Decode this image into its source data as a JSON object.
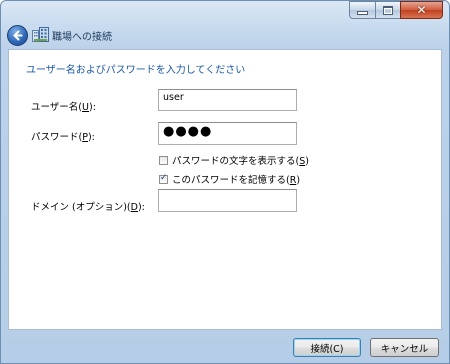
{
  "window": {
    "title": "職場への接続",
    "caption_buttons": [
      "minimize-icon",
      "maximize-icon",
      "close-icon"
    ]
  },
  "form": {
    "instruction": "ユーザー名およびパスワードを入力してください",
    "username": {
      "label_prefix": "ユーザー名(",
      "label_key": "U",
      "label_suffix": "):",
      "value": "user"
    },
    "password": {
      "label_prefix": "パスワード(",
      "label_key": "P",
      "label_suffix": "):",
      "value_masked": "●●●●"
    },
    "show_chars": {
      "label_prefix": "パスワードの文字を表示する(",
      "label_key": "S",
      "label_suffix": ")",
      "checked": false
    },
    "remember": {
      "label_prefix": "このパスワードを記憶する(",
      "label_key": "R",
      "label_suffix": ")",
      "checked": true
    },
    "domain": {
      "label_prefix": "ドメイン (オプション)(",
      "label_key": "D",
      "label_suffix": "):",
      "value": ""
    }
  },
  "buttons": {
    "connect": "接続(C)",
    "cancel": "キャンセル"
  }
}
